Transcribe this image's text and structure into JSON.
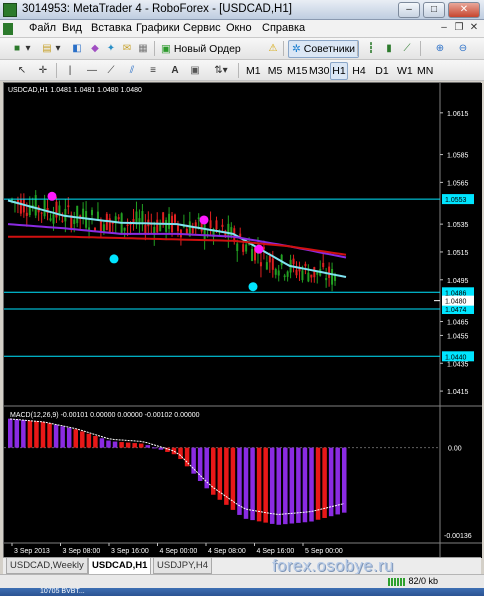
{
  "window": {
    "title": "3014953: MetaTrader 4 - RoboForex - [USDCAD,H1]",
    "minimize_label": "–",
    "maximize_label": "□",
    "close_label": "✕"
  },
  "menu": {
    "items": [
      "Файл",
      "Вид",
      "Вставка",
      "Графики",
      "Сервис",
      "Окно",
      "Справка"
    ],
    "mdi_minimize": "–",
    "mdi_restore": "❐",
    "mdi_close": "✕"
  },
  "toolbar1": {
    "new_order_label": "Новый Ордер",
    "advisors_label": "Советники"
  },
  "toolbar2": {
    "timeframes": [
      "M1",
      "M5",
      "M15",
      "M30",
      "H1",
      "H4",
      "D1",
      "W1",
      "MN"
    ],
    "active_timeframe": "H1",
    "text_tool": "A"
  },
  "chart": {
    "header": "USDCAD,H1  1.0481 1.0481 1.0480 1.0480",
    "macd_header": "MACD(12,26,9) -0.00101 0.00000 0.00000 -0.00102 0.00000",
    "price_ticks": [
      "1.0615",
      "1.0585",
      "1.0565",
      "1.0535",
      "1.0515",
      "1.0495",
      "1.0465",
      "1.0455",
      "1.0435",
      "1.0415"
    ],
    "price_ticks_y": [
      1.0615,
      1.0585,
      1.0565,
      1.0535,
      1.0515,
      1.0495,
      1.0465,
      1.0455,
      1.0435,
      1.0415
    ],
    "price_range": [
      1.0405,
      1.0635
    ],
    "hlines": [
      {
        "label": "1.0553",
        "value": 1.0553
      },
      {
        "label": "1.0486",
        "value": 1.0486
      },
      {
        "label": "1.0474",
        "value": 1.0474
      },
      {
        "label": "1.0440",
        "value": 1.044
      }
    ],
    "current_price_label": "1.0480",
    "current_price": 1.048,
    "macd_ticks": [
      "0.00",
      "-0.00136"
    ],
    "time_labels": [
      "3 Sep 2013",
      "3 Sep 08:00",
      "3 Sep 16:00",
      "4 Sep 00:00",
      "4 Sep 08:00",
      "4 Sep 16:00",
      "5 Sep 00:00"
    ],
    "colors": {
      "background": "#000000",
      "bull_candle": "#22a022",
      "bear_candle": "#e02020",
      "hline": "#00e5ff",
      "ema_fast": "#7fe3f0",
      "ema_mid": "#8a2be2",
      "ema_slow": "#d01010",
      "macd_pos": "#8a2be2",
      "macd_neg": "#e81818",
      "signal_line": "#ffffff",
      "dot_magenta": "#ff1aff",
      "dot_cyan": "#00e5ff"
    }
  },
  "chart_data": {
    "type": "line",
    "title": "USDCAD,H1",
    "x": [
      "3 Sep 2013",
      "3 Sep 08:00",
      "3 Sep 16:00",
      "4 Sep 00:00",
      "4 Sep 08:00",
      "4 Sep 16:00",
      "5 Sep 00:00"
    ],
    "series": [
      {
        "name": "",
        "values": [
          1.0552,
          1.0541,
          1.0536,
          1.0535,
          1.0528,
          1.0505,
          1.0497
        ]
      },
      {
        "name": "",
        "values": [
          1.0535,
          1.0532,
          1.0528,
          1.0528,
          1.0526,
          1.0519,
          1.0511
        ]
      },
      {
        "name": "",
        "values": [
          1.0526,
          1.0526,
          1.0525,
          1.0524,
          1.0523,
          1.0519,
          1.0513
        ]
      }
    ],
    "ylim": [
      1.0405,
      1.0635
    ],
    "macd": {
      "values": [
        0.00045,
        0.0004,
        0.00028,
        0.0001,
        6e-05,
        -0.00012,
        -0.0007,
        -0.0011,
        -0.0012,
        -0.00115,
        -0.00101
      ],
      "ylim": [
        -0.00145,
        0.0006
      ]
    }
  },
  "tabs": [
    "USDCAD,Weekly",
    "USDCAD,H1",
    "USDJPY,H4"
  ],
  "active_tab": "USDCAD,H1",
  "watermark": "forex.osobye.ru",
  "status": {
    "traffic": "82/0 kb"
  },
  "taskbar": {
    "item": "10705 BVBT..."
  }
}
